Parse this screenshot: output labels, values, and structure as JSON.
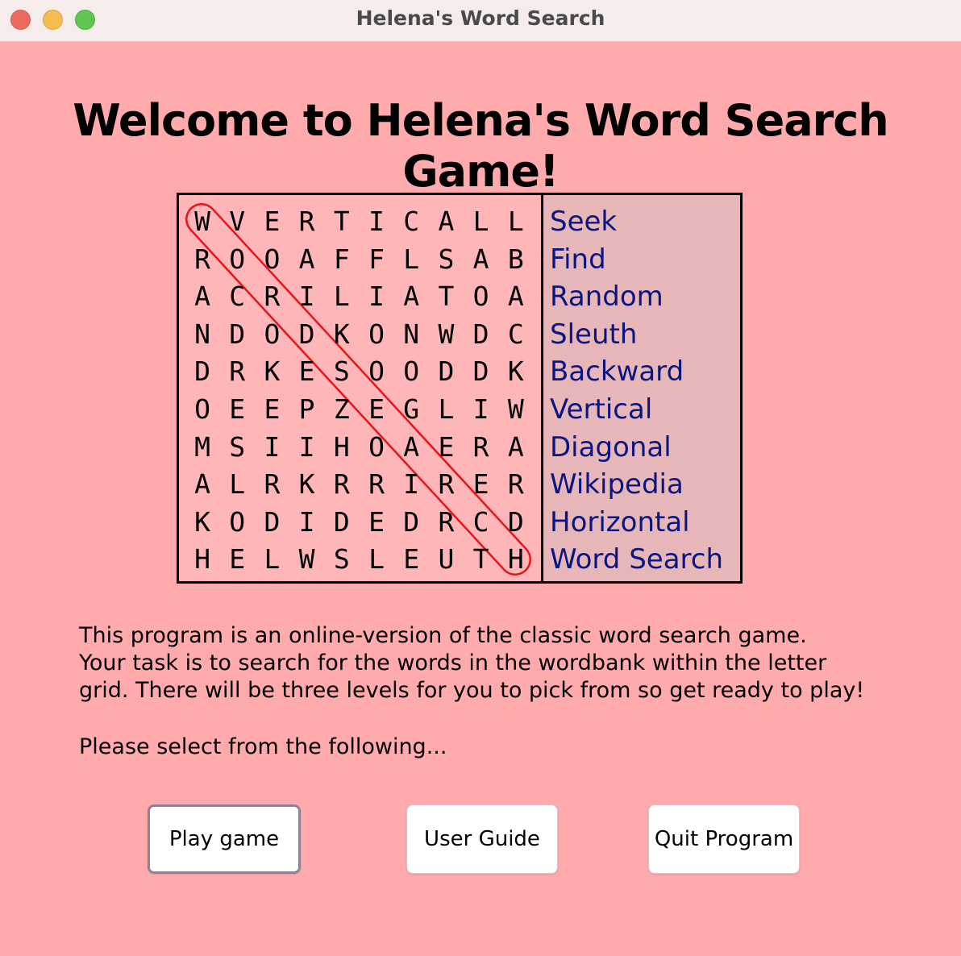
{
  "window": {
    "title": "Helena's Word Search"
  },
  "heading": "Welcome to Helena's Word Search Game!",
  "puzzle": {
    "grid": [
      [
        "W",
        "V",
        "E",
        "R",
        "T",
        "I",
        "C",
        "A",
        "L",
        "L"
      ],
      [
        "R",
        "O",
        "O",
        "A",
        "F",
        "F",
        "L",
        "S",
        "A",
        "B"
      ],
      [
        "A",
        "C",
        "R",
        "I",
        "L",
        "I",
        "A",
        "T",
        "O",
        "A"
      ],
      [
        "N",
        "D",
        "O",
        "D",
        "K",
        "O",
        "N",
        "W",
        "D",
        "C"
      ],
      [
        "D",
        "R",
        "K",
        "E",
        "S",
        "O",
        "O",
        "D",
        "D",
        "K"
      ],
      [
        "O",
        "E",
        "E",
        "P",
        "Z",
        "E",
        "G",
        "L",
        "I",
        "W"
      ],
      [
        "M",
        "S",
        "I",
        "I",
        "H",
        "O",
        "A",
        "E",
        "R",
        "A"
      ],
      [
        "A",
        "L",
        "R",
        "K",
        "R",
        "R",
        "I",
        "R",
        "E",
        "R"
      ],
      [
        "K",
        "O",
        "D",
        "I",
        "D",
        "E",
        "D",
        "R",
        "C",
        "D"
      ],
      [
        "H",
        "E",
        "L",
        "W",
        "S",
        "L",
        "E",
        "U",
        "T",
        "H"
      ]
    ],
    "wordbank": [
      "Seek",
      "Find",
      "Random",
      "Sleuth",
      "Backward",
      "Vertical",
      "Diagonal",
      "Wikipedia",
      "Horizontal",
      "Word Search"
    ],
    "circle_color": "#e8141b",
    "word_color": "#0b1580"
  },
  "description": [
    "This program is an online-version of the classic word search game.",
    "Your task is to search for the words in the wordbank within the letter",
    "grid. There will be three levels for you to pick from so get ready to play!"
  ],
  "prompt": "Please select from the following...",
  "buttons": {
    "play": "Play game",
    "guide": "User Guide",
    "quit": "Quit Program"
  }
}
